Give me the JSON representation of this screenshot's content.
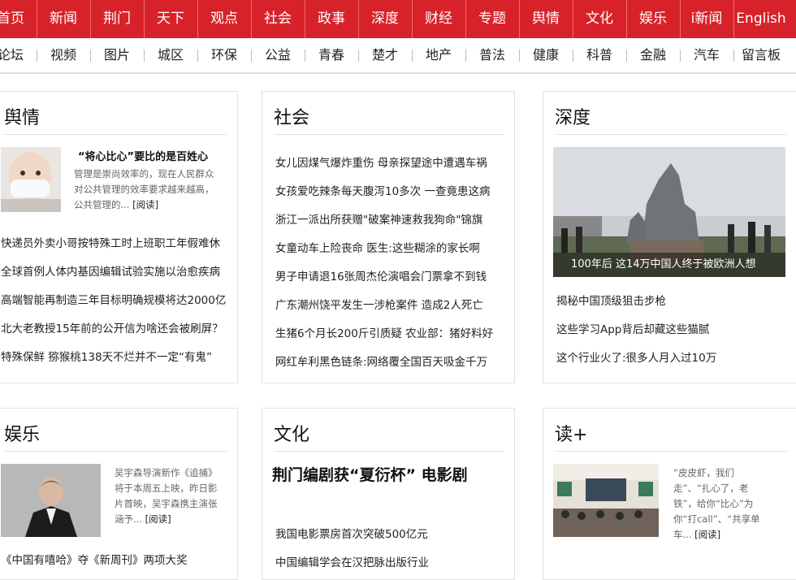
{
  "top_nav": [
    "首页",
    "新闻",
    "荆门",
    "天下",
    "观点",
    "社会",
    "政事",
    "深度",
    "财经",
    "专题",
    "舆情",
    "文化",
    "娱乐",
    "i新闻",
    "English"
  ],
  "sub_nav": [
    "论坛",
    "视频",
    "图片",
    "城区",
    "环保",
    "公益",
    "青春",
    "楚才",
    "地产",
    "普法",
    "健康",
    "科普",
    "金融",
    "汽车",
    "留言板"
  ],
  "colors": {
    "brand_red": "#d8222a"
  },
  "yuqing": {
    "title": "舆情",
    "feature": {
      "title": "“将心比心”要比的是百姓心",
      "desc_lines": [
        "管理是崇尚效率的，现在人民群众",
        "对公共管理的效率要求越来越高，",
        "公共管理的..."
      ],
      "more": "[阅读]"
    },
    "items": [
      "快递员外卖小哥按特殊工时上班职工年假难休",
      "全球首例人体内基因编辑试验实施以治愈疾病",
      "高端智能再制造三年目标明确规模将达2000亿",
      "北大老教授15年前的公开信为啥还会被刷屏？",
      "特殊保鲜 猕猴桃138天不烂并不一定“有鬼”"
    ]
  },
  "shehui": {
    "title": "社会",
    "items": [
      "女儿因煤气爆炸重伤 母亲探望途中遭遇车祸",
      "女孩爱吃辣条每天腹泻10多次 一查竟患这病",
      "浙江一派出所获赠\"破案神速救我狗命\"锦旗",
      "女童动车上险丧命 医生:这些糊涂的家长啊",
      "男子申请退16张周杰伦演唱会门票拿不到钱",
      "广东潮州饶平发生一涉枪案件 造成2人死亡",
      "生猪6个月长200斤引质疑 农业部：猪好料好",
      "网红牟利黑色链条:网络覆全国百天吸金千万"
    ]
  },
  "shendu": {
    "title": "深度",
    "caption": "100年后 这14万中国人终于被欧洲人想",
    "items": [
      "揭秘中国顶级狙击步枪",
      "这些学习App背后却藏这些猫腻",
      "这个行业火了:很多人月入过10万"
    ]
  },
  "yule": {
    "title": "娱乐",
    "desc_lines": [
      "吴宇森导演新作《追捕》",
      "将于本周五上映，昨日影",
      "片首映，吴宇森携主演张",
      "涵予..."
    ],
    "more": "[阅读]",
    "items": [
      "《中国有嘻哈》夺《新周刊》两项大奖"
    ]
  },
  "wenhua": {
    "title": "文化",
    "headline": "荆门编剧获“夏衍杯” 电影剧",
    "items": [
      "我国电影票房首次突破500亿元",
      "中国编辑学会在汉把脉出版行业"
    ]
  },
  "du": {
    "title": "读+",
    "desc_lines": [
      "“皮皮虾，我们",
      "走”、“扎心了，老",
      "铁”，给你“比心”为",
      "你“打call”、“共享单",
      "车..."
    ],
    "more": "[阅读]"
  }
}
